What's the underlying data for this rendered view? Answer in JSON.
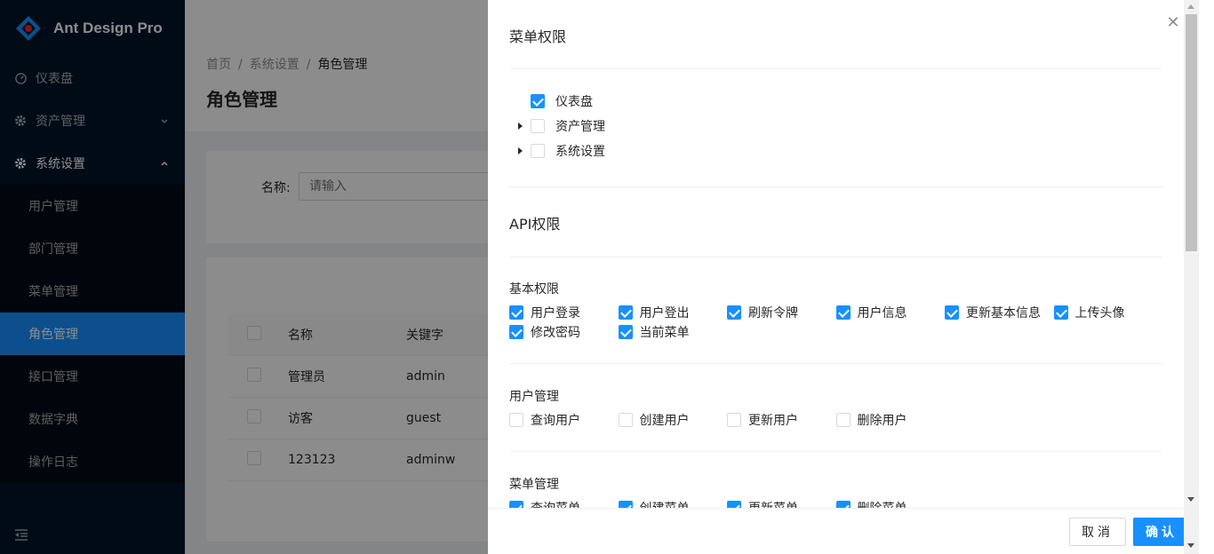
{
  "app": {
    "title": "Ant Design Pro"
  },
  "sidebar": {
    "items": [
      {
        "label": "仪表盘",
        "icon": "dashboard-icon"
      },
      {
        "label": "资产管理",
        "icon": "gear-icon"
      },
      {
        "label": "系统设置",
        "icon": "gear-icon"
      }
    ],
    "submenu": [
      {
        "label": "用户管理"
      },
      {
        "label": "部门管理"
      },
      {
        "label": "菜单管理"
      },
      {
        "label": "角色管理",
        "selected": true
      },
      {
        "label": "接口管理"
      },
      {
        "label": "数据字典"
      },
      {
        "label": "操作日志"
      }
    ]
  },
  "breadcrumb": {
    "home": "首页",
    "parent": "系统设置",
    "current": "角色管理"
  },
  "page": {
    "title": "角色管理"
  },
  "search": {
    "label": "名称:",
    "placeholder": "请输入"
  },
  "table": {
    "columns": [
      "名称",
      "关键字"
    ],
    "rows": [
      {
        "name": "管理员",
        "key": "admin"
      },
      {
        "name": "访客",
        "key": "guest"
      },
      {
        "name": "123123",
        "key": "adminw"
      }
    ]
  },
  "drawer": {
    "menu_perm_title": "菜单权限",
    "tree": [
      {
        "label": "仪表盘",
        "checked": true,
        "expandable": false
      },
      {
        "label": "资产管理",
        "checked": false,
        "expandable": true
      },
      {
        "label": "系统设置",
        "checked": false,
        "expandable": true
      }
    ],
    "api_perm_title": "API权限",
    "groups": [
      {
        "title": "基本权限",
        "items": [
          {
            "label": "用户登录",
            "checked": true
          },
          {
            "label": "用户登出",
            "checked": true
          },
          {
            "label": "刷新令牌",
            "checked": true
          },
          {
            "label": "用户信息",
            "checked": true
          },
          {
            "label": "更新基本信息",
            "checked": true
          },
          {
            "label": "上传头像",
            "checked": true
          },
          {
            "label": "修改密码",
            "checked": true
          },
          {
            "label": "当前菜单",
            "checked": true
          }
        ]
      },
      {
        "title": "用户管理",
        "items": [
          {
            "label": "查询用户",
            "checked": false
          },
          {
            "label": "创建用户",
            "checked": false
          },
          {
            "label": "更新用户",
            "checked": false
          },
          {
            "label": "删除用户",
            "checked": false
          }
        ]
      },
      {
        "title": "菜单管理",
        "items": [
          {
            "label": "查询菜单",
            "checked": true
          },
          {
            "label": "创建菜单",
            "checked": true
          },
          {
            "label": "更新菜单",
            "checked": true
          },
          {
            "label": "删除菜单",
            "checked": true
          }
        ]
      }
    ],
    "cancel_label": "取消",
    "ok_label": "确认"
  },
  "colors": {
    "primary": "#1890ff",
    "sider": "#001529",
    "submenu": "#000c17"
  }
}
